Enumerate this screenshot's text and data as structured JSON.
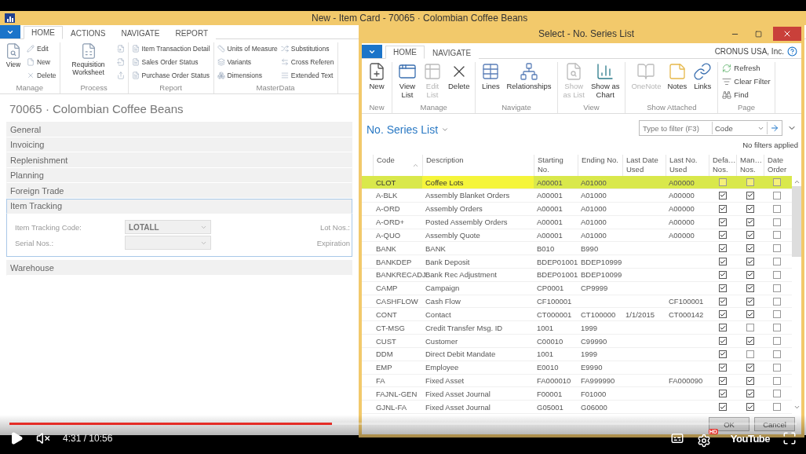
{
  "left_window": {
    "title": "New - Item Card - 70065 · Colombian Coffee Beans",
    "tabs": [
      {
        "label": "HOME",
        "selected": true
      },
      {
        "label": "ACTIONS",
        "selected": false
      },
      {
        "label": "NAVIGATE",
        "selected": false
      },
      {
        "label": "REPORT",
        "selected": false
      }
    ],
    "ribbon_groups": [
      {
        "label": "Manage",
        "items": [
          {
            "label": "View",
            "kind": "large"
          },
          {
            "label": "Edit",
            "kind": "small"
          },
          {
            "label": "New",
            "kind": "small"
          },
          {
            "label": "Delete",
            "kind": "small"
          }
        ]
      },
      {
        "label": "Process",
        "items": [
          {
            "label": "Requisition Worksheet",
            "kind": "large"
          },
          {
            "kind": "icon"
          },
          {
            "kind": "icon"
          },
          {
            "kind": "icon"
          }
        ]
      },
      {
        "label": "Report",
        "items": [
          {
            "label": "Item Transaction Detail",
            "kind": "small"
          },
          {
            "label": "Sales Order Status",
            "kind": "small"
          },
          {
            "label": "Purchase Order Status",
            "kind": "small"
          }
        ]
      },
      {
        "label": "MasterData",
        "items": [
          {
            "label": "Units of Measure",
            "kind": "small"
          },
          {
            "label": "Variants",
            "kind": "small"
          },
          {
            "label": "Dimensions",
            "kind": "small"
          },
          {
            "label": "Substitutions",
            "kind": "small"
          },
          {
            "label": "Cross Referen",
            "kind": "small"
          },
          {
            "label": "Extended Text",
            "kind": "small"
          }
        ]
      }
    ],
    "item_title": "70065 · Colombian Coffee Beans",
    "fasttabs": [
      {
        "label": "General",
        "expanded": false
      },
      {
        "label": "Invoicing",
        "expanded": false
      },
      {
        "label": "Replenishment",
        "expanded": false
      },
      {
        "label": "Planning",
        "expanded": false
      },
      {
        "label": "Foreign Trade",
        "expanded": false
      },
      {
        "label": "Item Tracking",
        "expanded": true,
        "fields": [
          {
            "label": "Item Tracking Code:",
            "value": "LOTALL"
          },
          {
            "label": "Serial Nos.:"
          }
        ],
        "right_labels": [
          "Lot Nos.:",
          "Expiration"
        ]
      },
      {
        "label": "Warehouse",
        "expanded": false
      }
    ]
  },
  "dialog": {
    "title": "Select - No. Series List",
    "tabs": [
      {
        "label": "HOME",
        "selected": true
      },
      {
        "label": "NAVIGATE",
        "selected": false
      }
    ],
    "company": "CRONUS USA, Inc.",
    "ribbon_groups": [
      {
        "label": "New",
        "items": [
          {
            "label": "New",
            "kind": "large",
            "disabled": false
          }
        ]
      },
      {
        "label": "Manage",
        "items": [
          {
            "label": "View\nList",
            "kind": "large",
            "disabled": false
          },
          {
            "label": "Edit\nList",
            "kind": "large",
            "disabled": true
          },
          {
            "label": "Delete",
            "kind": "large",
            "disabled": false
          }
        ]
      },
      {
        "label": "Navigate",
        "items": [
          {
            "label": "Lines",
            "kind": "large",
            "disabled": false
          },
          {
            "label": "Relationships",
            "kind": "large",
            "disabled": false
          }
        ]
      },
      {
        "label": "View",
        "items": [
          {
            "label": "Show\nas List",
            "kind": "large",
            "disabled": true
          },
          {
            "label": "Show as\nChart",
            "kind": "large",
            "disabled": false
          }
        ]
      },
      {
        "label": "Show Attached",
        "items": [
          {
            "label": "OneNote",
            "kind": "large",
            "disabled": true
          },
          {
            "label": "Notes",
            "kind": "large",
            "disabled": false
          },
          {
            "label": "Links",
            "kind": "large",
            "disabled": false
          }
        ]
      },
      {
        "label": "Page",
        "items": [
          {
            "label": "Refresh",
            "kind": "small",
            "disabled": false
          },
          {
            "label": "Clear Filter",
            "kind": "small",
            "disabled": false
          },
          {
            "label": "Find",
            "kind": "small",
            "disabled": false
          }
        ]
      }
    ],
    "list_title": "No. Series List",
    "filter": {
      "placeholder": "Type to filter (F3)",
      "field": "Code"
    },
    "filter_status": "No filters applied",
    "columns": [
      "Code",
      "Description",
      "Starting\nNo.",
      "Ending No.",
      "Last Date\nUsed",
      "Last No.\nUsed",
      "Defa…\nNos.",
      "Man…\nNos.",
      "Date\nOrder"
    ],
    "rows": [
      {
        "code": "CLOT",
        "description": "Coffee Lots",
        "starting_no": "A00001",
        "ending_no": "A01000",
        "last_no_used": "A00000",
        "default_nos": false,
        "manual_nos": false,
        "date_order": false,
        "selected": true
      },
      {
        "code": "A-BLK",
        "description": "Assembly Blanket Orders",
        "starting_no": "A00001",
        "ending_no": "A01000",
        "last_no_used": "A00000",
        "default_nos": true,
        "manual_nos": true,
        "date_order": false,
        "selected": false
      },
      {
        "code": "A-ORD",
        "description": "Assembly Orders",
        "starting_no": "A00001",
        "ending_no": "A01000",
        "last_no_used": "A00000",
        "default_nos": true,
        "manual_nos": true,
        "date_order": false,
        "selected": false
      },
      {
        "code": "A-ORD+",
        "description": "Posted Assembly Orders",
        "starting_no": "A00001",
        "ending_no": "A01000",
        "last_no_used": "A00000",
        "default_nos": true,
        "manual_nos": true,
        "date_order": false,
        "selected": false
      },
      {
        "code": "A-QUO",
        "description": "Assembly Quote",
        "starting_no": "A00001",
        "ending_no": "A01000",
        "last_no_used": "A00000",
        "default_nos": true,
        "manual_nos": true,
        "date_order": false,
        "selected": false
      },
      {
        "code": "BANK",
        "description": "BANK",
        "starting_no": "B010",
        "ending_no": "B990",
        "default_nos": true,
        "manual_nos": true,
        "date_order": false,
        "selected": false
      },
      {
        "code": "BANKDEP",
        "description": "Bank Deposit",
        "starting_no": "BDEP01001",
        "ending_no": "BDEP10999",
        "default_nos": true,
        "manual_nos": true,
        "date_order": false,
        "selected": false
      },
      {
        "code": "BANKRECADJ",
        "description": "Bank Rec Adjustment",
        "starting_no": "BDEP01001",
        "ending_no": "BDEP10099",
        "default_nos": true,
        "manual_nos": true,
        "date_order": false,
        "selected": false
      },
      {
        "code": "CAMP",
        "description": "Campaign",
        "starting_no": "CP0001",
        "ending_no": "CP9999",
        "default_nos": true,
        "manual_nos": true,
        "date_order": false,
        "selected": false
      },
      {
        "code": "CASHFLOW",
        "description": "Cash Flow",
        "starting_no": "CF100001",
        "last_no_used": "CF100001",
        "default_nos": true,
        "manual_nos": true,
        "date_order": false,
        "selected": false
      },
      {
        "code": "CONT",
        "description": "Contact",
        "starting_no": "CT000001",
        "ending_no": "CT100000",
        "last_date_used": "1/1/2015",
        "last_no_used": "CT000142",
        "default_nos": true,
        "manual_nos": true,
        "date_order": false,
        "selected": false
      },
      {
        "code": "CT-MSG",
        "description": "Credit Transfer Msg. ID",
        "starting_no": "1001",
        "ending_no": "1999",
        "default_nos": true,
        "manual_nos": false,
        "date_order": false,
        "selected": false
      },
      {
        "code": "CUST",
        "description": "Customer",
        "starting_no": "C00010",
        "ending_no": "C99990",
        "default_nos": true,
        "manual_nos": true,
        "date_order": false,
        "selected": false
      },
      {
        "code": "DDM",
        "description": "Direct Debit Mandate",
        "starting_no": "1001",
        "ending_no": "1999",
        "default_nos": true,
        "manual_nos": false,
        "date_order": false,
        "selected": false
      },
      {
        "code": "EMP",
        "description": "Employee",
        "starting_no": "E0010",
        "ending_no": "E9990",
        "default_nos": true,
        "manual_nos": true,
        "date_order": false,
        "selected": false
      },
      {
        "code": "FA",
        "description": "Fixed Asset",
        "starting_no": "FA000010",
        "ending_no": "FA999990",
        "last_no_used": "FA000090",
        "default_nos": true,
        "manual_nos": true,
        "date_order": false,
        "selected": false
      },
      {
        "code": "FAJNL-GEN",
        "description": "Fixed Asset Journal",
        "starting_no": "F00001",
        "ending_no": "F01000",
        "default_nos": true,
        "manual_nos": true,
        "date_order": false,
        "selected": false
      },
      {
        "code": "GJNL-FA",
        "description": "Fixed Asset Journal",
        "starting_no": "G05001",
        "ending_no": "G06000",
        "default_nos": true,
        "manual_nos": true,
        "date_order": false,
        "selected": false
      }
    ],
    "buttons": [
      "OK",
      "Cancel"
    ]
  },
  "player": {
    "time": "4:31 / 10:56",
    "level": 0.41,
    "muted": true,
    "hd_badge": "HD",
    "logo": "YouTube"
  }
}
